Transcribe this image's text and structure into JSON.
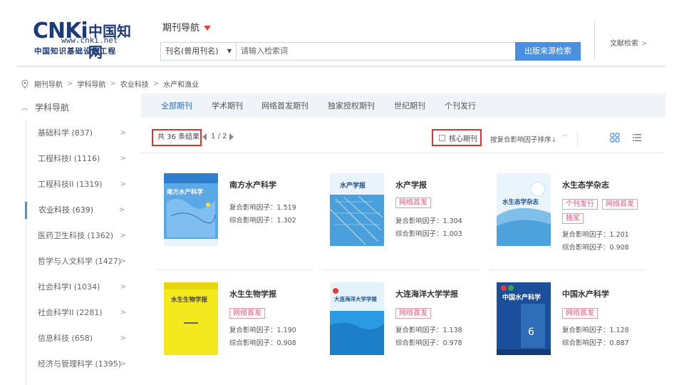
{
  "header": {
    "logo_main": "CNKi",
    "logo_cn": "中国知网",
    "logo_url": "www.cnki.net",
    "logo_sub": "中国知识基础设施工程",
    "journal_nav": "期刊导航",
    "search_select": "刊名(曾用刊名)",
    "search_placeholder": "请输入检索词",
    "search_button": "出版来源检索",
    "advanced_search": "文献检索"
  },
  "breadcrumb": [
    "期刊导航",
    "学科导航",
    "农业科技",
    "水产和渔业"
  ],
  "sidebar": {
    "title": "学科导航",
    "items": [
      {
        "label": "基础科学 (837)"
      },
      {
        "label": "工程科技I (1116)"
      },
      {
        "label": "工程科技II (1319)"
      },
      {
        "label": "农业科技 (639)"
      },
      {
        "label": "医药卫生科技 (1362)"
      },
      {
        "label": "哲学与人文科学 (1427)"
      },
      {
        "label": "社会科学I (1034)"
      },
      {
        "label": "社会科学II (2281)"
      },
      {
        "label": "信息科技 (658)"
      },
      {
        "label": "经济与管理科学 (1395)"
      }
    ],
    "active_index": 3
  },
  "tabs": [
    "全部期刊",
    "学术期刊",
    "网络首发期刊",
    "独家授权期刊",
    "世纪期刊",
    "个刊发行"
  ],
  "filter": {
    "result_text": "共 36 条结果",
    "page": "1",
    "page_total": "/ 2",
    "core_label": "核心期刊",
    "sort_label": "按复合影响因子排序",
    "sort_arrow": "↓"
  },
  "journals": [
    {
      "title": "南方水产科学",
      "cover_text": "南方水产科学",
      "tags": [],
      "metrics": [
        "复合影响因子：1.519",
        "综合影响因子：1.302"
      ]
    },
    {
      "title": "水产学报",
      "cover_text": "水产学报",
      "tags": [
        "网络首发"
      ],
      "metrics": [
        "复合影响因子：1.304",
        "综合影响因子：1.003"
      ]
    },
    {
      "title": "水生态学杂志",
      "cover_text": "水生态学杂志",
      "tags": [
        "个刊发行",
        "网络首发",
        "独家"
      ],
      "metrics": [
        "复合影响因子：1.201",
        "综合影响因子：0.908"
      ]
    },
    {
      "title": "水生生物学报",
      "cover_text": "水生生物学报",
      "tags": [
        "网络首发"
      ],
      "metrics": [
        "复合影响因子：1.190",
        "综合影响因子：0.908"
      ]
    },
    {
      "title": "大连海洋大学学报",
      "cover_text": "大连海洋大学学报",
      "tags": [
        "网络首发"
      ],
      "metrics": [
        "复合影响因子：1.138",
        "综合影响因子：0.978"
      ]
    },
    {
      "title": "中国水产科学",
      "cover_text": "中国水产科学",
      "tags": [
        "网络首发"
      ],
      "metrics": [
        "复合影响因子：1.128",
        "综合影响因子：0.887"
      ]
    }
  ],
  "colors": {
    "accent": "#4a90e2",
    "highlight_box": "#dd3333",
    "tag": "#e05a7a",
    "tab_bg": "#f0f3f8"
  }
}
